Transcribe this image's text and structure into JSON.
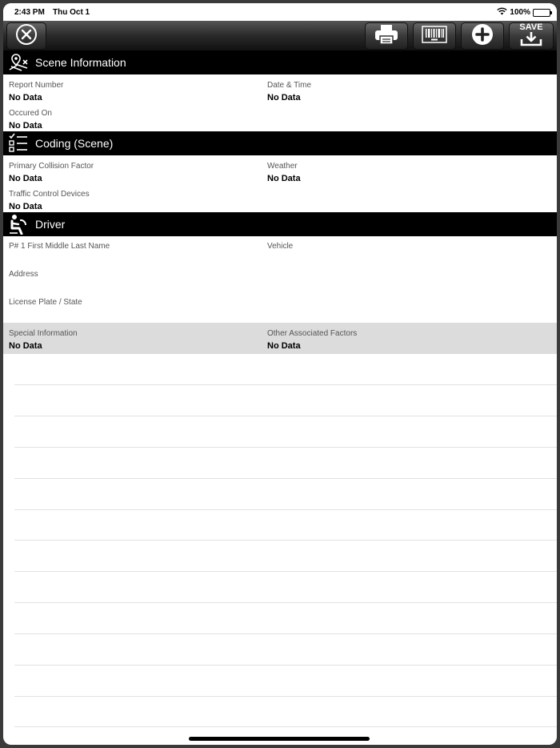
{
  "status_bar": {
    "time": "2:43 PM",
    "date": "Thu Oct 1",
    "battery": "100%"
  },
  "toolbar": {
    "close_icon": "close-circle-icon",
    "print_icon": "printer-icon",
    "barcode_icon": "barcode-icon",
    "add_icon": "plus-circle-icon",
    "save_label": "SAVE"
  },
  "sections": {
    "scene": {
      "title": "Scene Information",
      "report_number_label": "Report Number",
      "report_number_value": "No Data",
      "date_time_label": "Date & Time",
      "date_time_value": "No Data",
      "occured_on_label": "Occured On",
      "occured_on_value": "No Data"
    },
    "coding": {
      "title": "Coding (Scene)",
      "pcf_label": "Primary Collision Factor",
      "pcf_value": "No Data",
      "weather_label": "Weather",
      "weather_value": "No Data",
      "tcd_label": "Traffic Control Devices",
      "tcd_value": "No Data"
    },
    "driver": {
      "title": "Driver",
      "name_label": "P# 1 First Middle Last Name",
      "vehicle_label": "Vehicle",
      "address_label": "Address",
      "plate_label": "License Plate / State",
      "special_label": "Special Information",
      "special_value": "No Data",
      "other_label": "Other Associated Factors",
      "other_value": "No Data"
    }
  },
  "colors": {
    "header_bg": "#000000",
    "band_bg": "#dcdcdc"
  }
}
